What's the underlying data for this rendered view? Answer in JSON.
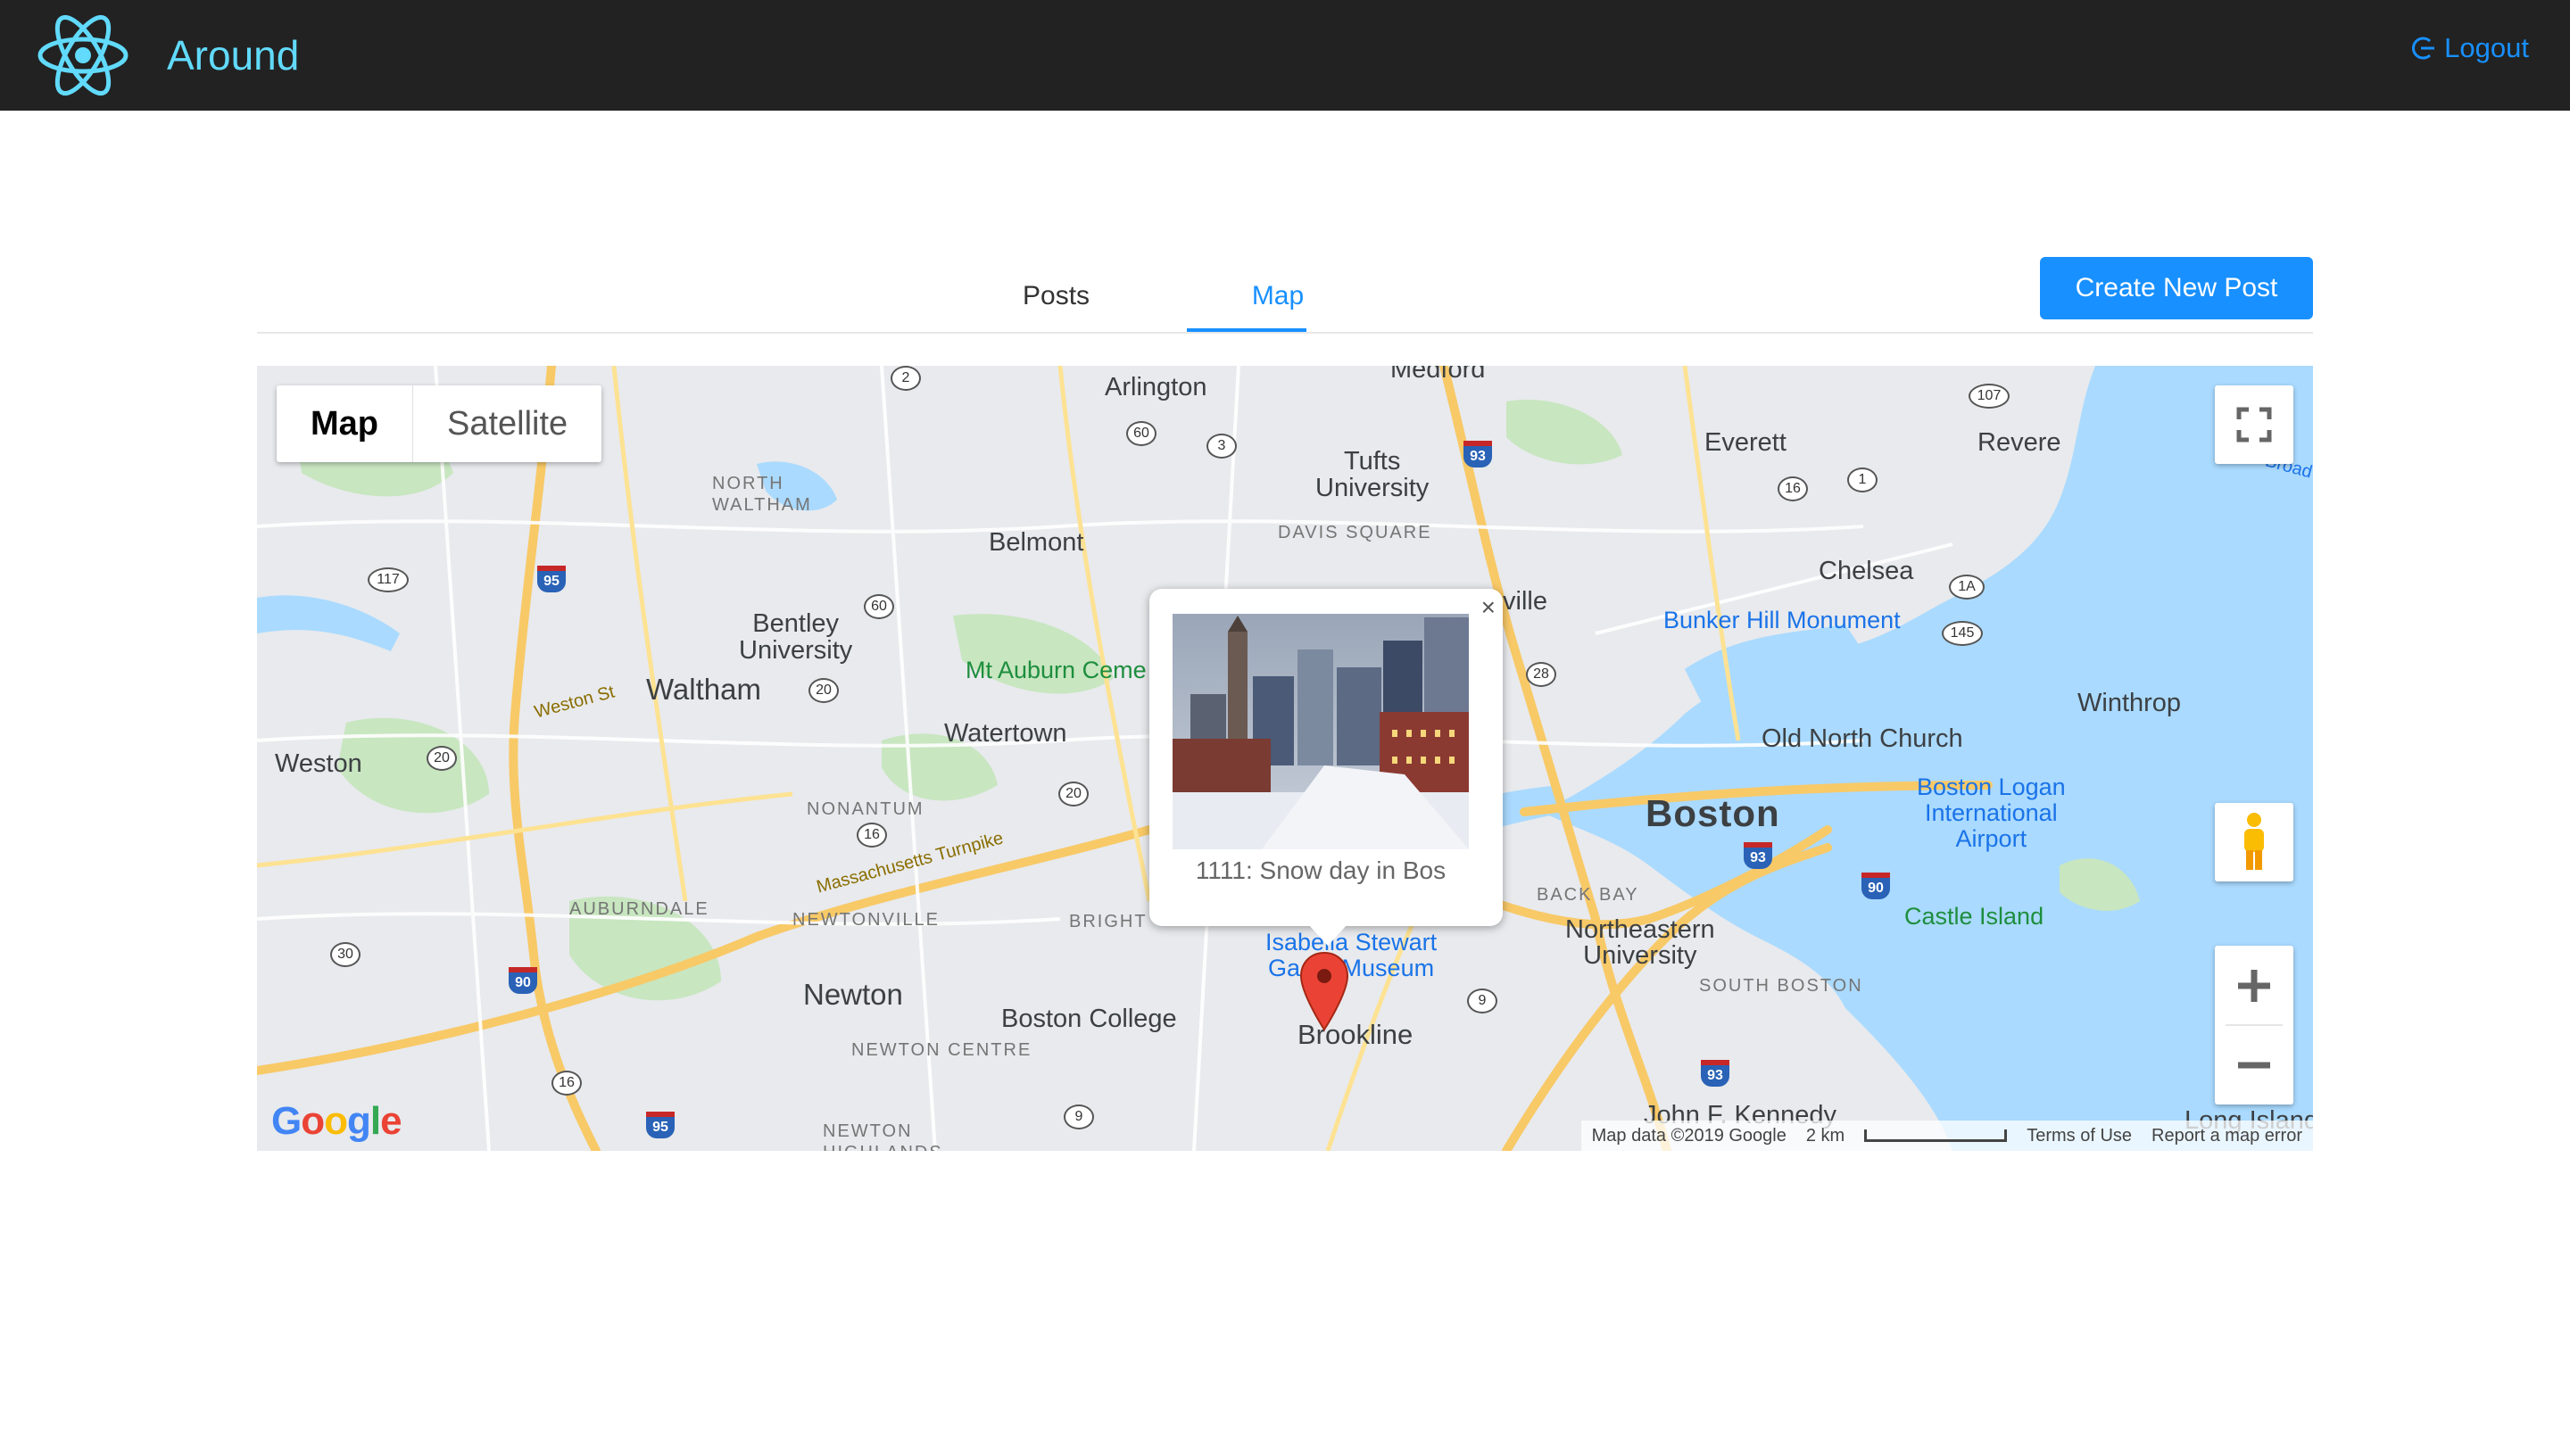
{
  "header": {
    "app_title": "Around",
    "logout_label": "Logout"
  },
  "tabs": [
    {
      "label": "Posts",
      "active": false
    },
    {
      "label": "Map",
      "active": true
    }
  ],
  "create_button_label": "Create New Post",
  "map": {
    "type_controls": [
      "Map",
      "Satellite"
    ],
    "selected_type": "Map",
    "labels": {
      "medford": "Medford",
      "arlington": "Arlington",
      "tufts": "Tufts\nUniversity",
      "davis": "DAVIS SQUARE",
      "everett": "Everett",
      "revere": "Revere",
      "north_waltham": "NORTH\nWALTHAM",
      "belmont": "Belmont",
      "chelsea": "Chelsea",
      "bentley": "Bentley\nUniversity",
      "somerville": "ville",
      "bunker": "Bunker Hill Monument",
      "waltham": "Waltham",
      "weston_st": "Weston St",
      "mt_auburn": "Mt Auburn Ceme",
      "winthrop": "Winthrop",
      "old_north": "Old North Church",
      "weston": "Weston",
      "watertown": "Watertown",
      "logan": "Boston Logan\nInternational\nAirport",
      "boston": "Boston",
      "nonantum": "NONANTUM",
      "mass_pike": "Massachusetts Turnpike",
      "auburndale": "AUBURNDALE",
      "newtonville": "NEWTONVILLE",
      "brighton": "BRIGHT",
      "back_bay": "BACK BAY",
      "castle_island": "Castle Island",
      "gardner": "Isabella Stewart\nGa    r Museum",
      "northeastern": "Northeastern\nUniversity",
      "newton": "Newton",
      "boston_college": "Boston College",
      "south_boston": "SOUTH BOSTON",
      "brookline": "Brookline",
      "newton_centre": "NEWTON CENTRE",
      "newton_highlands": "NEWTON\nHIGHLANDS",
      "jfk": "John F. Kennedy",
      "long_island": "Long Island",
      "broad": "Broad"
    },
    "shields": [
      "2",
      "60",
      "3",
      "107",
      "16",
      "1",
      "117",
      "60",
      "1A",
      "145",
      "28",
      "20",
      "20",
      "20",
      "16",
      "30",
      "9",
      "16",
      "9"
    ],
    "interstates": [
      "95",
      "93",
      "93",
      "90",
      "90",
      "93",
      "95"
    ],
    "info_window": {
      "caption": "1111: Snow day in Bos"
    },
    "footer": {
      "map_data": "Map data ©2019 Google",
      "scale_label": "2 km",
      "terms": "Terms of Use",
      "report": "Report a map error"
    },
    "google_logo": "Google"
  }
}
